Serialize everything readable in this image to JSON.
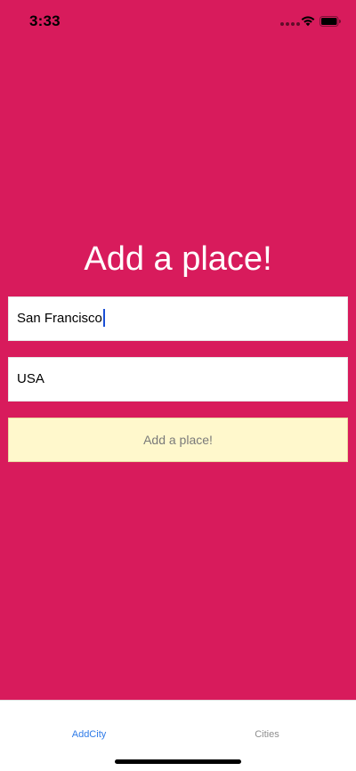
{
  "status_bar": {
    "time": "3:33"
  },
  "main": {
    "title": "Add a place!",
    "city_input": {
      "value": "San Francisco",
      "focused": true
    },
    "country_input": {
      "value": "USA"
    },
    "add_button_label": "Add a place!"
  },
  "tab_bar": {
    "tabs": [
      {
        "label": "AddCity",
        "active": true
      },
      {
        "label": "Cities",
        "active": false
      }
    ]
  },
  "colors": {
    "background": "#d81b5c",
    "button_bg": "#fff8cc",
    "active_tab": "#2f7be8",
    "inactive_tab": "#8e8e8e"
  },
  "icons": [
    "cellular-signal-icon",
    "wifi-icon",
    "battery-icon"
  ]
}
